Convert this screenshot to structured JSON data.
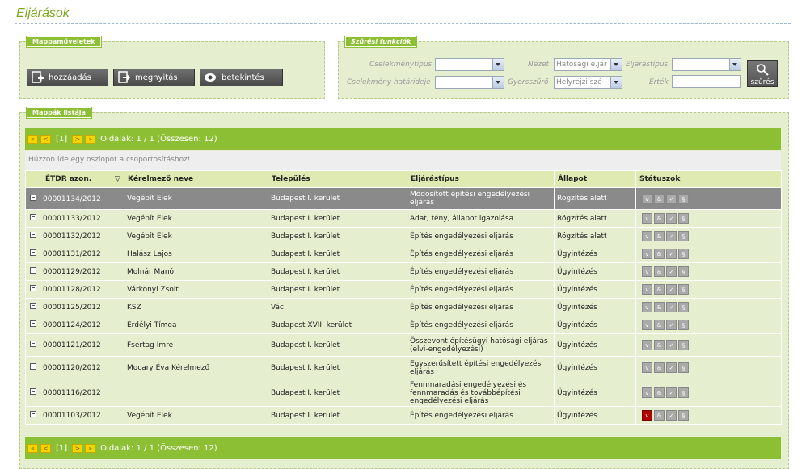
{
  "page_title": "Eljárások",
  "folder_ops": {
    "legend": "Mappaműveletek",
    "buttons": [
      {
        "label": "hozzáadás",
        "icon": "add-document-icon"
      },
      {
        "label": "megnyitás",
        "icon": "open-arrow-icon"
      },
      {
        "label": "betekintés",
        "icon": "eye-icon"
      }
    ]
  },
  "filter": {
    "legend": "Szűrési funkciók",
    "cselekmenytipus_label": "Cselekménytípus",
    "cselekmeny_hatarideje_label": "Cselekmény határideje",
    "nezet_label": "Nézet",
    "nezet_value": "Hatósági e.jár",
    "gyorsszuro_label": "Gyorsszűrő",
    "gyorsszuro_value": "Helyrejzi szé",
    "eljarastipus_label": "Eljárástípus",
    "ertek_label": "Érték",
    "search_button_label": "szűrés"
  },
  "list": {
    "legend": "Mappák listája",
    "pager": {
      "first": "«",
      "prev": "<",
      "page": "[1]",
      "next": ">",
      "last": "»",
      "info": "Oldalak: 1 / 1 (Összesen: 12)"
    },
    "group_hint": "Húzzon ide egy oszlopot a csoportosításhoz!",
    "columns": [
      "ÉTDR azon.",
      "Kérelmező neve",
      "Település",
      "Eljárástípus",
      "Állapot",
      "Státuszok"
    ],
    "rows": [
      {
        "id": "00001134/2012",
        "name": "Vegépít Elek",
        "town": "Budapest I. kerület",
        "type": "Módosított építési engedélyezési eljárás",
        "state": "Rögzítés alatt"
      },
      {
        "id": "00001133/2012",
        "name": "Vegépít Elek",
        "town": "Budapest I. kerület",
        "type": "Adat, tény, állapot igazolása",
        "state": "Rögzítés alatt"
      },
      {
        "id": "00001132/2012",
        "name": "Vegépít Elek",
        "town": "Budapest I. kerület",
        "type": "Építés engedélyezési eljárás",
        "state": "Rögzítés alatt"
      },
      {
        "id": "00001131/2012",
        "name": "Halász Lajos",
        "town": "Budapest I. kerület",
        "type": "Építés engedélyezési eljárás",
        "state": "Ügyintézés"
      },
      {
        "id": "00001129/2012",
        "name": "Molnár Manó",
        "town": "Budapest I. kerület",
        "type": "Építés engedélyezési eljárás",
        "state": "Ügyintézés"
      },
      {
        "id": "00001128/2012",
        "name": "Várkonyi Zsolt",
        "town": "Budapest I. kerület",
        "type": "Építés engedélyezési eljárás",
        "state": "Ügyintézés"
      },
      {
        "id": "00001125/2012",
        "name": "KSZ",
        "town": "Vác",
        "type": "Építés engedélyezési eljárás",
        "state": "Ügyintézés"
      },
      {
        "id": "00001124/2012",
        "name": "Erdélyi Tímea",
        "town": "Budapest XVII. kerület",
        "type": "Építés engedélyezési eljárás",
        "state": "Ügyintézés"
      },
      {
        "id": "00001121/2012",
        "name": "Fsertag Imre",
        "town": "Budapest I. kerület",
        "type": "Összevont építésügyi hatósági eljárás (elvi-engedélyezési)",
        "state": "Ügyintézés"
      },
      {
        "id": "00001120/2012",
        "name": "Mocary Éva Kérelmező",
        "town": "Budapest I. kerület",
        "type": "Egyszerűsített építési engedélyezési eljárás",
        "state": "Ügyintézés"
      },
      {
        "id": "00001116/2012",
        "name": "",
        "town": "Budapest I. kerület",
        "type": "Fennmaradási engedélyezési és fennmaradás és továbbépítési engedélyezési eljárás",
        "state": "Ügyintézés"
      },
      {
        "id": "00001103/2012",
        "name": "Vegépít Elek",
        "town": "Budapest I. kerület",
        "type": "Építés engedélyezési eljárás",
        "state": "Ügyintézés"
      }
    ]
  },
  "colors": {
    "accent": "#8cbf33",
    "panel": "#e6eed0",
    "title": "#7aa81a",
    "selected_row": "#8a8a8a"
  }
}
